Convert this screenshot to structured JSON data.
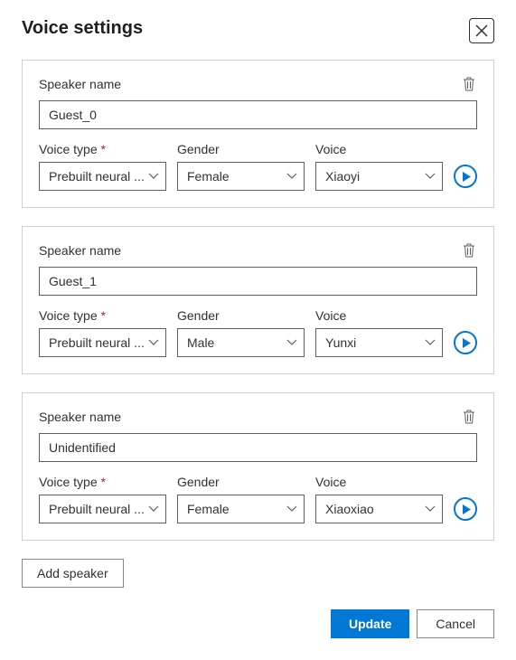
{
  "dialog": {
    "title": "Voice settings",
    "labels": {
      "speaker_name": "Speaker name",
      "voice_type": "Voice type",
      "gender": "Gender",
      "voice": "Voice"
    },
    "speakers": [
      {
        "name": "Guest_0",
        "voice_type": "Prebuilt neural ...",
        "gender": "Female",
        "voice": "Xiaoyi"
      },
      {
        "name": "Guest_1",
        "voice_type": "Prebuilt neural ...",
        "gender": "Male",
        "voice": "Yunxi"
      },
      {
        "name": "Unidentified",
        "voice_type": "Prebuilt neural ...",
        "gender": "Female",
        "voice": "Xiaoxiao"
      }
    ],
    "buttons": {
      "add_speaker": "Add speaker",
      "update": "Update",
      "cancel": "Cancel"
    }
  }
}
